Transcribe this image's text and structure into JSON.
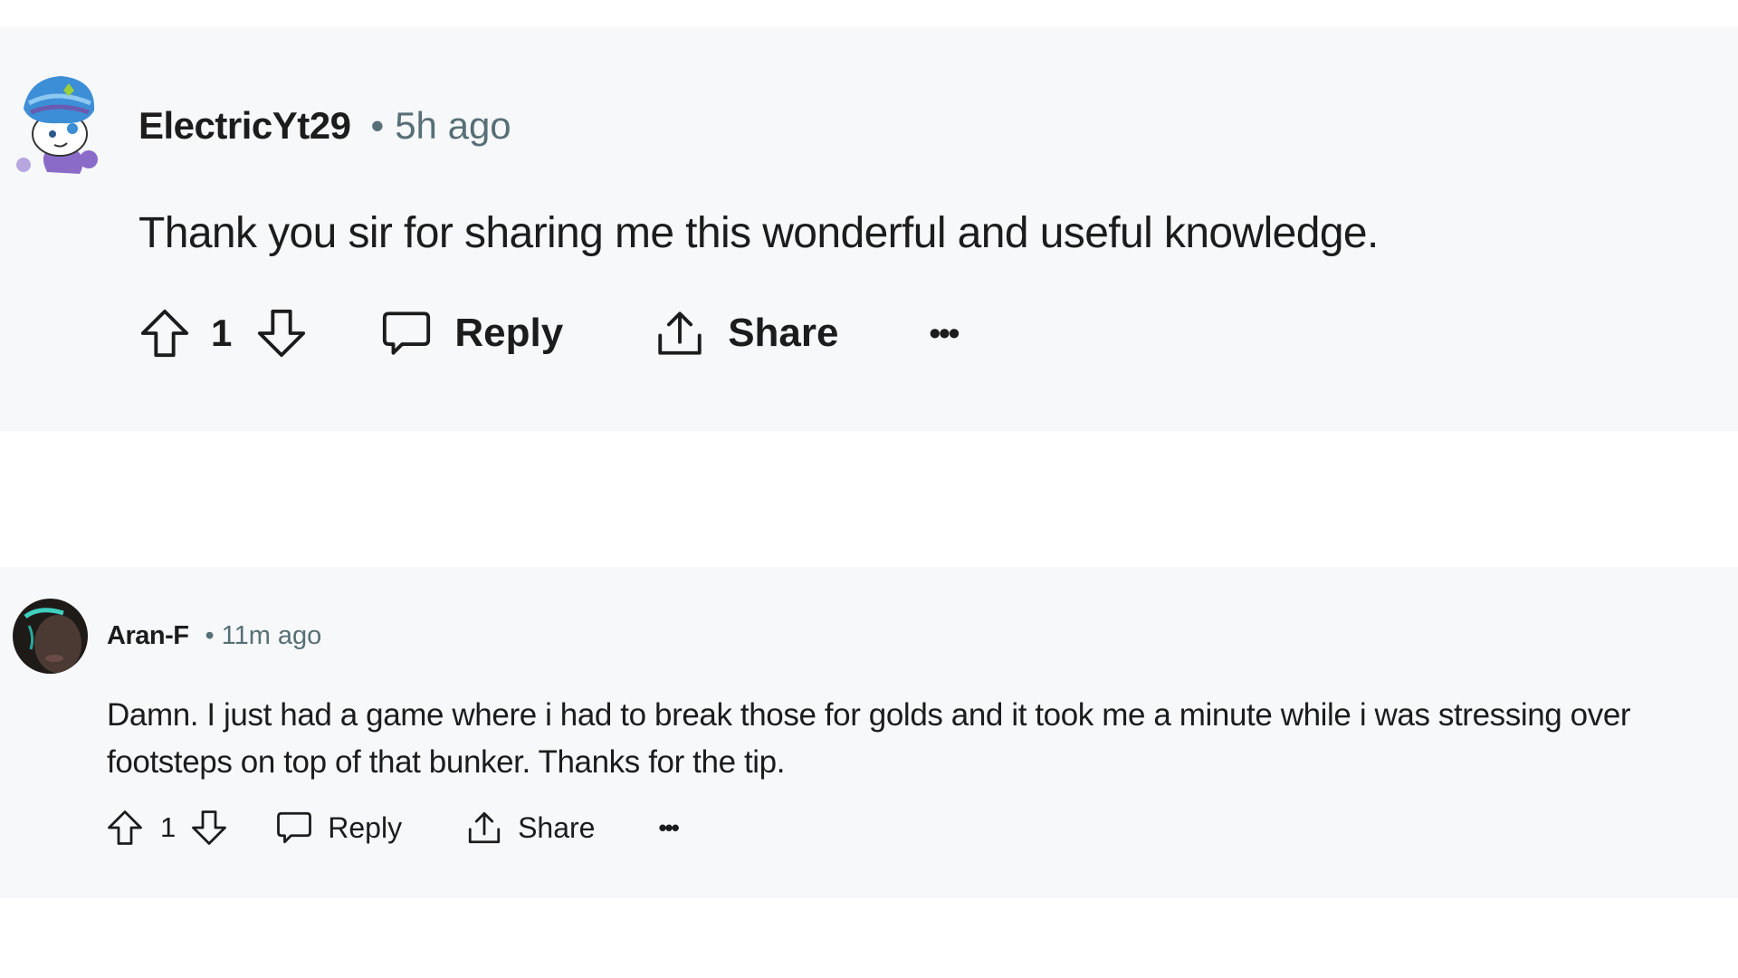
{
  "comments": [
    {
      "author": "ElectricYt29",
      "separator": "•",
      "time": "5h ago",
      "avatar_icon": "snoo-avatar-turban",
      "body": "Thank you sir for sharing me this wonderful and useful knowledge.",
      "votes": "1",
      "reply_label": "Reply",
      "share_label": "Share",
      "more_label": "•••"
    },
    {
      "author": "Aran-F",
      "separator": "•",
      "time": "11m ago",
      "avatar_icon": "user-photo-avatar",
      "body": "Damn. I just had a game where i had to break those for golds and it took me a minute while i was stressing over footsteps on top of that bunker. Thanks for the tip.",
      "votes": "1",
      "reply_label": "Reply",
      "share_label": "Share",
      "more_label": "•••"
    }
  ],
  "colors": {
    "panel_bg": "#f7f8fa",
    "text": "#1c1c1c",
    "muted": "#576f76"
  }
}
